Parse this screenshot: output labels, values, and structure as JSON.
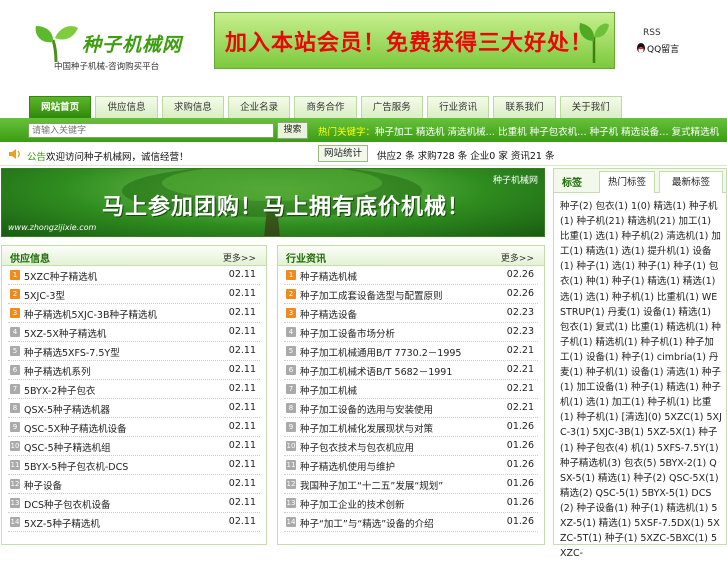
{
  "header": {
    "logo_title": "种子机械网",
    "logo_subtitle": "中国种子机械-咨询购买平台",
    "ad_text": "加入本站会员！免费获得三大好处！",
    "rss": "RSS",
    "qq": "QQ留言"
  },
  "nav": {
    "tabs": [
      "网站首页",
      "供应信息",
      "求购信息",
      "企业名录",
      "商务合作",
      "广告服务",
      "行业资讯",
      "联系我们",
      "关于我们"
    ]
  },
  "search": {
    "placeholder": "请输入关键字",
    "button": "搜索",
    "hot_first": "热门关键字：",
    "hot_rest": "种子加工 精选机 清选机械… 比重机 种子包衣机… 种子机 精选设备… 复式精选机"
  },
  "news": {
    "prefix": "公告",
    "text": "欢迎访问种子机械网，诚信经营！",
    "stats_label": "网站统计",
    "stats": "供应2 条 求购728 条 企业0 家 资讯21 条"
  },
  "group_banner": {
    "text": "马上参加团购！马上拥有底价机械！",
    "brand": "种子机械网",
    "url": "www.zhongzijixie.com"
  },
  "left_list": {
    "title": "供应信息",
    "more": "更多>>",
    "items": [
      {
        "title": "5XZC种子精选机",
        "date": "02.11"
      },
      {
        "title": "5XJC-3型",
        "date": "02.11"
      },
      {
        "title": "种子精选机5XJC-3B种子精选机",
        "date": "02.11"
      },
      {
        "title": "5XZ-5X种子精选机",
        "date": "02.11"
      },
      {
        "title": "种子精选5XFS-7.5Y型",
        "date": "02.11"
      },
      {
        "title": "种子精选机系列",
        "date": "02.11"
      },
      {
        "title": "5BYX-2种子包衣",
        "date": "02.11"
      },
      {
        "title": "QSX-5种子精选机器",
        "date": "02.11"
      },
      {
        "title": "QSC-5X种子精选机设备",
        "date": "02.11"
      },
      {
        "title": "QSC-5种子精选机组",
        "date": "02.11"
      },
      {
        "title": "5BYX-5种子包衣机-DCS",
        "date": "02.11"
      },
      {
        "title": "种子设备",
        "date": "02.11"
      },
      {
        "title": "DCS种子包衣机设备",
        "date": "02.11"
      },
      {
        "title": "5XZ-5种子精选机",
        "date": "02.11"
      }
    ]
  },
  "mid_list": {
    "title": "行业资讯",
    "more": "更多>>",
    "items": [
      {
        "title": "种子精选机械",
        "date": "02.26"
      },
      {
        "title": "种子加工成套设备选型与配置原则",
        "date": "02.26"
      },
      {
        "title": "种子精选设备",
        "date": "02.23"
      },
      {
        "title": "种子加工设备市场分析",
        "date": "02.23"
      },
      {
        "title": "种子加工机械通用B/T 7730.2－1995",
        "date": "02.21"
      },
      {
        "title": "种子加工机械术语B/T 5682－1991",
        "date": "02.21"
      },
      {
        "title": "种子加工机械",
        "date": "02.21"
      },
      {
        "title": "种子加工设备的选用与安装使用",
        "date": "02.21"
      },
      {
        "title": "种子加工机械化发展现状与对策",
        "date": "01.26"
      },
      {
        "title": "种子包衣技术与包衣机应用",
        "date": "01.26"
      },
      {
        "title": "种子精选机使用与维护",
        "date": "01.26"
      },
      {
        "title": "我国种子加工“十二五”发展“规划”",
        "date": "01.26"
      },
      {
        "title": "种子加工企业的技术创新",
        "date": "01.26"
      },
      {
        "title": "种子“加工”与“精选”设备的介绍",
        "date": "01.26"
      }
    ]
  },
  "sidebar": {
    "title": "标签",
    "tab1": "热门标签",
    "tab2": "最新标签",
    "tags": "种子(2) 包衣(1) 1(0) 精选(1) 种子机(1) 种子机(21) 精选机(21) 加工(1) 比重(1) 选(1) 种子机(2) 清选机(1) 加工(1) 精选(1) 选(1) 提升机(1) 设备(1) 种子(1) 选(1) 种子(1) 种子(1) 包衣(1) 种(1) 种子(1) 精选(1) 精选(1) 选(1) 选(1) 种子机(1) 比重机(1) WESTRUP(1) 丹麦(1) 设备(1) 精选(1) 包衣(1) 复式(1) 比重(1) 精选机(1) 种子机(1) 精选机(1) 种子机(1) 种子加工(1) 设备(1) 种子(1) cimbria(1) 丹麦(1) 种子机(1) 设备(1) 清选(1) 种子(1) 加工设备(1) 种子(1) 精选(1) 种子机(1) 选(1) 加工(1) 种子机(1) 比重(1) 种子机(1) [清选](0) 5XZC(1) 5XJC-3(1) 5XJC-3B(1) 5XZ-5X(1) 种子(1) 种子包衣(4) 机(1) 5XFS-7.5Y(1) 种子精选机(3) 包衣(5) 5BYX-2(1) QSX-5(1) 精选(1) 种子(2) QSC-5X(1) 精选(2) QSC-5(1) 5BYX-5(1) DCS(2) 种子设备(1) 种子(1) 精选机(1) 5XZ-5(1) 精选(1) 5XSF-7.5DX(1) 5XZC-5T(1) 种子(1) 5XZC-5BXC(1) 5XZC-"
  },
  "colors": {
    "brand_green": "#3b9c14",
    "accent_orange": "#f08a1c",
    "ad_red": "#e8080a"
  }
}
